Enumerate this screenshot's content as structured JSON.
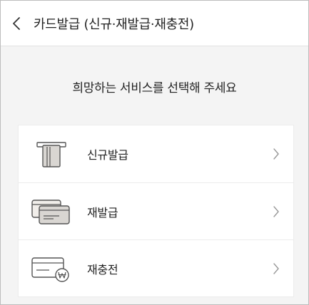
{
  "header": {
    "title": "카드발급 (신규·재발급·재충전)"
  },
  "prompt": "희망하는 서비스를 선택해 주세요",
  "options": [
    {
      "label": "신규발급",
      "icon": "card-slot-icon"
    },
    {
      "label": "재발급",
      "icon": "card-stack-icon"
    },
    {
      "label": "재충전",
      "icon": "card-won-icon"
    }
  ]
}
